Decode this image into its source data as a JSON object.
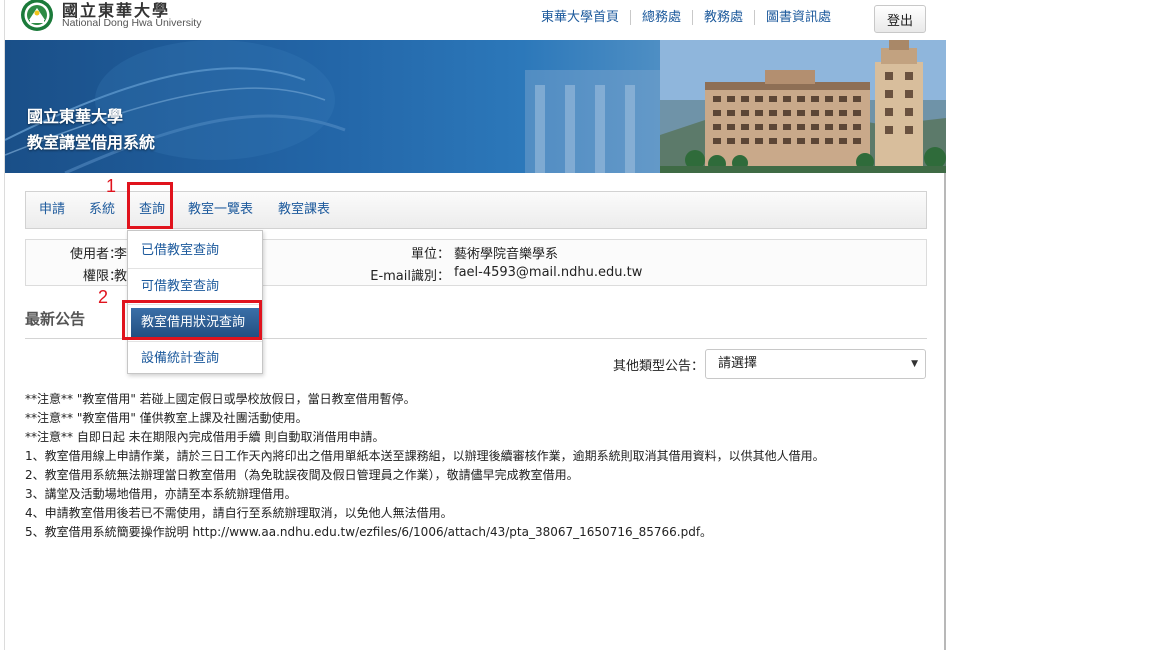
{
  "header": {
    "logo_zh": "國立東華大學",
    "logo_en": "National Dong Hwa University",
    "links": [
      "東華大學首頁",
      "總務處",
      "教務處",
      "圖書資訊處"
    ],
    "logout_label": "登出"
  },
  "banner": {
    "line1": "國立東華大學",
    "line2": "教室講堂借用系統"
  },
  "nav": {
    "items": [
      "申請",
      "系統",
      "查詢",
      "教室一覽表",
      "教室課表"
    ]
  },
  "dropdown": {
    "items": [
      "已借教室查詢",
      "可借教室查詢",
      "教室借用狀況查詢",
      "設備統計查詢"
    ],
    "active_index": 2
  },
  "annotations": {
    "step1": "1",
    "step2": "2",
    "color": "#e0131d"
  },
  "userinfo": {
    "user_label": "使用者：",
    "user_value": "李",
    "perm_label": "權限：",
    "perm_value": "教",
    "unit_label": "單位：",
    "unit_value": "藝術學院音樂學系",
    "email_label": "E-mail識別：",
    "email_value": "fael-4593@mail.ndhu.edu.tw"
  },
  "news": {
    "title": "最新公告",
    "other_label": "其他類型公告：",
    "select_value": "請選擇"
  },
  "notices": [
    "**注意** \"教室借用\" 若碰上國定假日或學校放假日，當日教室借用暫停。",
    "**注意** \"教室借用\" 僅供教室上課及社團活動使用。",
    "**注意** 自即日起 未在期限內完成借用手續 則自動取消借用申請。",
    "1、教室借用線上申請作業，請於三日工作天內將印出之借用單紙本送至課務組，以辦理後續審核作業，逾期系統則取消其借用資料，以供其他人借用。",
    "2、教室借用系統無法辦理當日教室借用（為免耽誤夜間及假日管理員之作業），敬請儘早完成教室借用。",
    "3、講堂及活動場地借用，亦請至本系統辦理借用。",
    "4、申請教室借用後若已不需使用，請自行至系統辦理取消，以免他人無法借用。",
    "5、教室借用系統簡要操作說明 http://www.aa.ndhu.edu.tw/ezfiles/6/1006/attach/43/pta_38067_1650716_85766.pdf。"
  ],
  "colors": {
    "link": "#1d5a9c",
    "active_bg": "#2b5a8e"
  }
}
